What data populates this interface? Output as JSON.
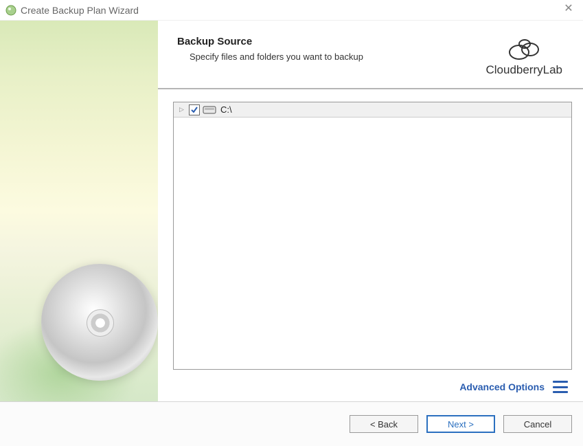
{
  "window": {
    "title": "Create Backup Plan Wizard"
  },
  "header": {
    "title": "Backup Source",
    "subtitle": "Specify files and folders you want to backup"
  },
  "brand": {
    "label": "CloudberryLab"
  },
  "tree": {
    "items": [
      {
        "label": "C:\\",
        "checked": true
      }
    ]
  },
  "advanced": {
    "label": "Advanced Options"
  },
  "footer": {
    "back": "< Back",
    "next": "Next >",
    "cancel": "Cancel"
  }
}
